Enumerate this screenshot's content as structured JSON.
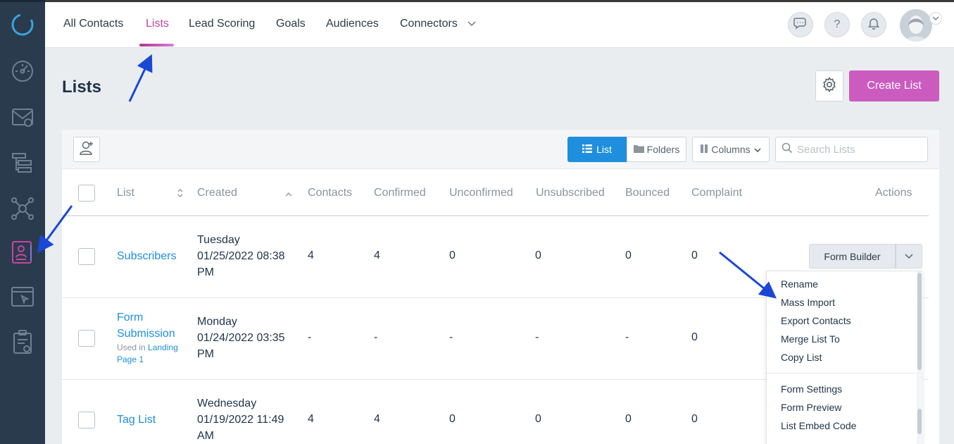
{
  "nav": {
    "tabs": [
      {
        "label": "All Contacts"
      },
      {
        "label": "Lists"
      },
      {
        "label": "Lead Scoring"
      },
      {
        "label": "Goals"
      },
      {
        "label": "Audiences"
      },
      {
        "label": "Connectors"
      }
    ],
    "active_tab": "Lists",
    "help_label": "?"
  },
  "page": {
    "title": "Lists",
    "create_button": "Create List"
  },
  "toolbar": {
    "list_view": "List",
    "folders_view": "Folders",
    "columns": "Columns",
    "search_placeholder": "Search Lists"
  },
  "table": {
    "headers": [
      "List",
      "Created",
      "Contacts",
      "Confirmed",
      "Unconfirmed",
      "Unsubscribed",
      "Bounced",
      "Complaint",
      "Actions"
    ],
    "rows": [
      {
        "name": "Subscribers",
        "created_day": "Tuesday",
        "created_date": "01/25/2022 08:38",
        "created_ampm": "PM",
        "contacts": "4",
        "confirmed": "4",
        "unconfirmed": "0",
        "unsubscribed": "0",
        "bounced": "0",
        "complaint": "0"
      },
      {
        "name_line1": "Form",
        "name_line2": "Submission",
        "used_in_prefix": "Used in",
        "used_in_link1": "Landing",
        "used_in_link2": "Page 1",
        "created_day": "Monday",
        "created_date": "01/24/2022 03:35",
        "created_ampm": "PM",
        "contacts": "-",
        "confirmed": "-",
        "unconfirmed": "-",
        "unsubscribed": "-",
        "bounced": "-",
        "complaint": "0"
      },
      {
        "name": "Tag List",
        "created_day": "Wednesday",
        "created_date": "01/19/2022 11:49",
        "created_ampm": "AM",
        "contacts": "4",
        "confirmed": "4",
        "unconfirmed": "0",
        "unsubscribed": "0",
        "bounced": "0",
        "complaint": "0"
      }
    ],
    "form_builder_label": "Form Builder"
  },
  "actions_menu": {
    "group1": [
      "Rename",
      "Mass Import",
      "Export Contacts",
      "Merge List To",
      "Copy List"
    ],
    "group2": [
      "Form Settings",
      "Form Preview",
      "List Embed Code"
    ]
  },
  "colors": {
    "sidebar": "#2a3b4d",
    "accent_pink": "#cc5bbf",
    "accent_blue": "#1f8fdd",
    "arrow_blue": "#1a47d6"
  }
}
